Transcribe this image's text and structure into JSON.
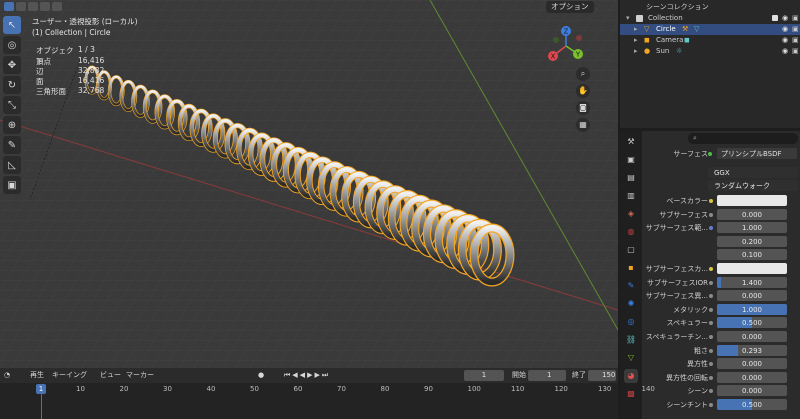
{
  "viewport": {
    "title": "ユーザー・透視投影 (ローカル)",
    "subtitle": "(1) Collection | Circle",
    "options_label": "オプション",
    "stats": [
      {
        "label": "オブジェクト",
        "value": "1 / 3"
      },
      {
        "label": "頂点",
        "value": "16,416"
      },
      {
        "label": "辺",
        "value": "32,832"
      },
      {
        "label": "面",
        "value": "16,416"
      },
      {
        "label": "三角形面",
        "value": "32,768"
      }
    ],
    "gizmo_axes": [
      "X",
      "Y",
      "Z"
    ]
  },
  "outliner": {
    "root": "シーンコレクション",
    "collection": "Collection",
    "items": [
      "Circle",
      "Camera",
      "Sun"
    ]
  },
  "properties": {
    "search_placeholder": "",
    "surface_label": "サーフェス",
    "surface_value": "プリンシプルBSDF",
    "distribution": "GGX",
    "subsurface_method": "ランダムウォーク",
    "rows": [
      {
        "label": "ベースカラー",
        "value": "",
        "type": "color"
      },
      {
        "label": "サブサーフェス",
        "value": "0.000",
        "fill": 0
      },
      {
        "label": "サブサーフェス範...",
        "value": "1.000",
        "fill": 0
      },
      {
        "label": "",
        "value": "0.200",
        "fill": 0
      },
      {
        "label": "",
        "value": "0.100",
        "fill": 0
      },
      {
        "label": "サブサーフェスカ...",
        "value": "",
        "type": "color"
      },
      {
        "label": "サブサーフェスIOR",
        "value": "1.400",
        "fill": 0.05
      },
      {
        "label": "サブサーフェス異...",
        "value": "0.000",
        "fill": 0
      },
      {
        "label": "メタリック",
        "value": "1.000",
        "fill": 1
      },
      {
        "label": "スペキュラー",
        "value": "0.500",
        "fill": 0.5
      },
      {
        "label": "スペキュラーチン...",
        "value": "0.000",
        "fill": 0
      },
      {
        "label": "粗さ",
        "value": "0.293",
        "fill": 0.293
      },
      {
        "label": "異方性",
        "value": "0.000",
        "fill": 0
      },
      {
        "label": "異方性の回転",
        "value": "0.000",
        "fill": 0
      },
      {
        "label": "シーン",
        "value": "0.000",
        "fill": 0
      },
      {
        "label": "シーンチント",
        "value": "0.500",
        "fill": 0.5
      }
    ]
  },
  "timeline": {
    "menu": [
      "再生",
      "キーイング",
      "ビュー",
      "マーカー"
    ],
    "current_frame": "1",
    "start_label": "開始",
    "start": "1",
    "end_label": "終了",
    "end": "150",
    "playhead": "1",
    "ticks": [
      "10",
      "20",
      "30",
      "40",
      "50",
      "60",
      "70",
      "80",
      "90",
      "100",
      "110",
      "120",
      "130",
      "140"
    ]
  },
  "colors": {
    "accent": "#4772b3",
    "selection": "#f4a623",
    "x_axis": "#e0474d",
    "y_axis": "#7ac02b",
    "z_axis": "#3d7fe0"
  }
}
